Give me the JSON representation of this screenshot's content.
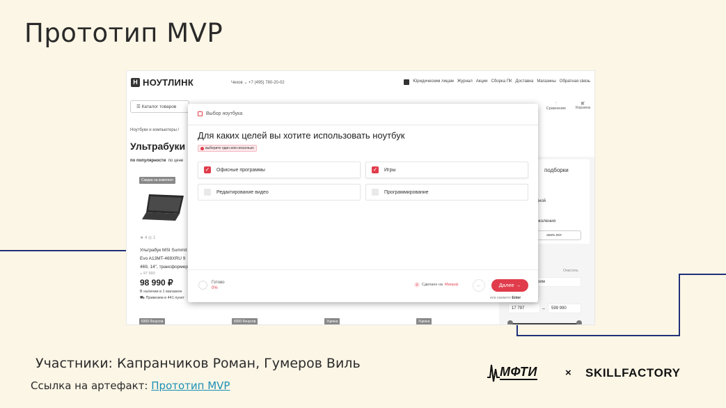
{
  "slide": {
    "title": "Прототип MVP",
    "participants": "Участники:  Капранчиков Роман, Гумеров Виль",
    "artifact_prefix": "Ссылка на артефакт: ",
    "artifact_link": "Прототип MVP"
  },
  "logos": {
    "mipt": "МФТИ",
    "times": "×",
    "skillfactory": "SKILLFACTORY"
  },
  "site": {
    "logo_letter": "Н",
    "logo_text": "НОУТЛИНК",
    "city": "Чехов ⌄  +7 (495) 780-20-02",
    "nav": [
      "Юридическим лицам",
      "Журнал",
      "Акции",
      "Сборка ПК",
      "Доставка",
      "Магазины",
      "Обратная связь"
    ],
    "catalog_label": "☰  Каталог товаров",
    "icons": [
      "Сравнение",
      "Корзина"
    ],
    "breadcrumb": "Ноутбуки и компьютеры /",
    "page_heading": "Ультрабуки",
    "sort_active": "по популярности",
    "sort_other": "по цене",
    "badges": [
      "Скидка на комплект",
      "8300 бонусов",
      "8300 бонусов",
      "Уценка",
      "Уценка"
    ],
    "product": {
      "rating": "★ 4   ◎ 1",
      "name": "Ультрабук MSI Summit Evo A13MT-469XRU 9 469, 14\", трансформер",
      "old_price": "◒ 97 990",
      "price": "98 990 ₽",
      "avail1": "В наличии в 1 магазине",
      "avail2": "⛟ Привезем в 441 пункт"
    },
    "right_panel": {
      "title": "подборки",
      "line1": "жной",
      "line2": "околения",
      "button": "азать все",
      "clear": "Очистить",
      "field": "рим",
      "price_from": "17 797",
      "price_to": "599 990"
    }
  },
  "modal": {
    "header": "Выбор ноутбука",
    "question": "Для каких целей вы хотите использовать ноутбук",
    "hint": "выберите один или несколько",
    "options": [
      {
        "label": "Офисные программы",
        "checked": true
      },
      {
        "label": "Игры",
        "checked": true
      },
      {
        "label": "Редактирование видео",
        "checked": false
      },
      {
        "label": "Программирование",
        "checked": false
      }
    ],
    "ready_label": "Готово",
    "ready_pct": "0%",
    "made_prefix": "Сделано на",
    "made_brand": "Marquiz",
    "next_label": "Далее  →",
    "back_label": "←",
    "enter_prefix": "или нажмите",
    "enter_key": "Enter"
  },
  "colors": {
    "accent": "#e03c4b",
    "line": "#1f2f7a",
    "background": "#fcf6e6"
  }
}
